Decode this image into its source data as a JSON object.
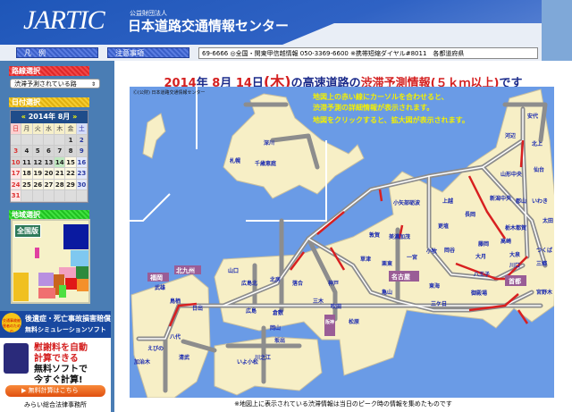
{
  "header": {
    "logo": "JARTIC",
    "org_small": "公益財団法人",
    "org_name": "日本道路交通情報センター"
  },
  "nav": {
    "legend": "凡　例",
    "notes": "注意事項",
    "ticker": "69-6666 ◎全国・関東甲信越情報 050-3369-6600 ※携帯短縮ダイヤル#8011　各都道府県"
  },
  "sidebar": {
    "route_heading": "路線選択",
    "route_select": "渋滞予測されている路",
    "date_heading": "日付選択",
    "calendar": {
      "prev": "«",
      "next": "»",
      "month_label": "2014年 8月",
      "weekdays": [
        "日",
        "月",
        "火",
        "水",
        "木",
        "金",
        "土"
      ],
      "weeks": [
        [
          "",
          "",
          "",
          "",
          "",
          "1",
          "2"
        ],
        [
          "3",
          "4",
          "5",
          "6",
          "7",
          "8",
          "9"
        ],
        [
          "10",
          "11",
          "12",
          "13",
          "14",
          "15",
          "16"
        ],
        [
          "17",
          "18",
          "19",
          "20",
          "21",
          "22",
          "23"
        ],
        [
          "24",
          "25",
          "26",
          "27",
          "28",
          "29",
          "30"
        ],
        [
          "31",
          "",
          "",
          "",
          "",
          "",
          ""
        ]
      ],
      "selected": "14"
    },
    "region_heading": "地域選択",
    "region_national": "全国版",
    "ad": {
      "badge": "交通事故被害者のための",
      "line1": "後遺症・死亡事故損害賠償",
      "line2": "無料シミュレーションソフト",
      "line3": "慰謝料を自動",
      "line4": "計算できる",
      "line5": "無料ソフトで",
      "line6": "今すぐ計算!",
      "button": "無料計算はこちら",
      "sponsor": "みらい総合法律事務所"
    }
  },
  "main": {
    "title_date_a": "2014",
    "title_date_b": "年 ",
    "title_date_c": "8",
    "title_date_d": "月 ",
    "title_date_e": "14",
    "title_date_f": "日",
    "title_day": "(木)",
    "title_mid": "の高速道路の",
    "title_red": "渋滞予測情報(５ｋｍ以上)",
    "title_end": "です",
    "copyright": "Ⓒ(公財) 日本道路交通情報センター",
    "info1": "地図上の赤い線にカーソルを合わせると、",
    "info2": "渋滞予測の詳細情報が表示されます。",
    "info3": "地図をクリックすると、拡大図が表示されます。",
    "labels": [
      "札幌",
      "千歳恵庭",
      "深川",
      "安代",
      "河辺",
      "北上",
      "仙台",
      "山形中央",
      "郡山",
      "いわき",
      "新潟中央",
      "上越",
      "長岡",
      "小矢部砺波",
      "更埴",
      "栃木都賀",
      "高崎",
      "大泉",
      "太田",
      "つくば",
      "三郷",
      "川口",
      "宮野木",
      "八王子",
      "大月",
      "藤岡",
      "岡谷",
      "一宮",
      "美濃加茂",
      "小牧",
      "亀山",
      "東海",
      "三ケ日",
      "敦賀",
      "草津",
      "栗東",
      "吹田",
      "神戸",
      "三木",
      "松原",
      "岡山",
      "倉敷",
      "北房",
      "落合",
      "広島北",
      "広島",
      "山口",
      "鳥栖",
      "日出",
      "八代",
      "えびの",
      "加治木",
      "清武",
      "坂出",
      "いよ小松",
      "川之江",
      "武雄",
      "御殿場"
    ],
    "boxes": [
      "名古屋",
      "首都",
      "阪神",
      "北九州",
      "福岡"
    ],
    "footnote": "※地図上に表示されている渋滞情報は当日のピーク時の情報を集めたものです"
  },
  "colors": {
    "sea": "#6a9be6",
    "land": "#f7efc6",
    "congestion": "#d82020",
    "road": "#9a9a9a"
  }
}
